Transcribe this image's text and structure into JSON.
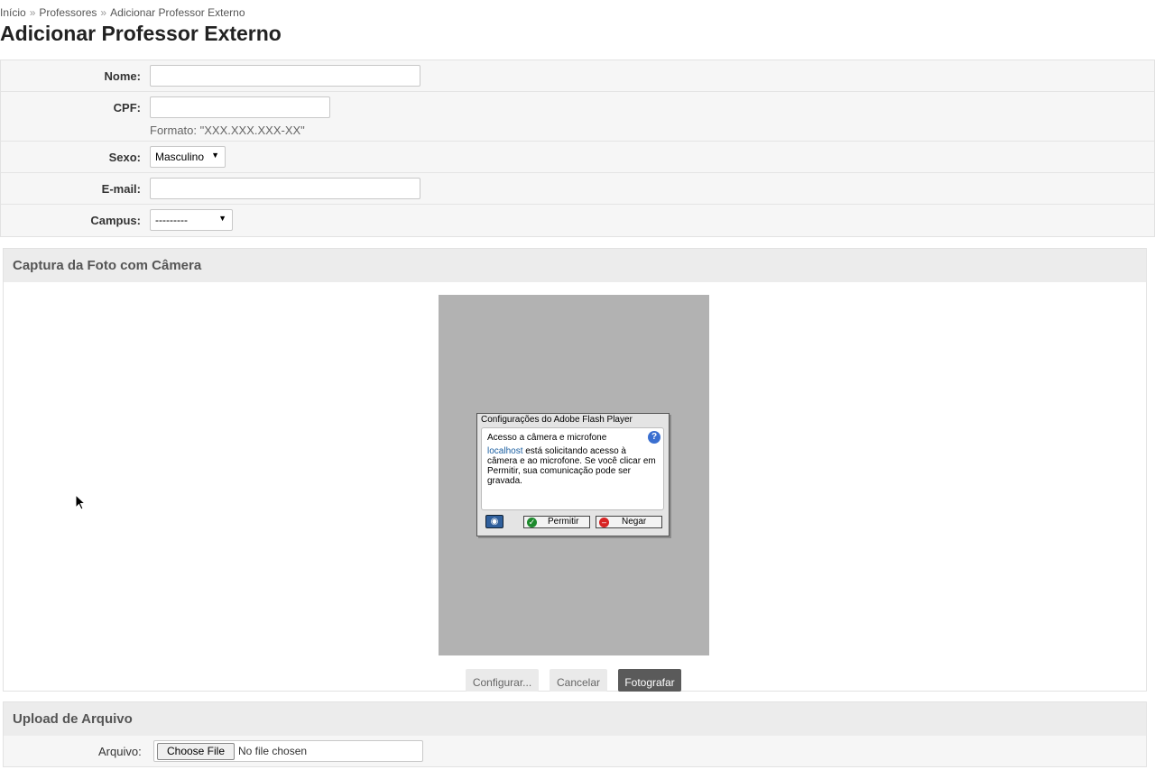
{
  "breadcrumb": {
    "items": [
      "Início",
      "Professores",
      "Adicionar Professor Externo"
    ],
    "separator": "»"
  },
  "page_title": "Adicionar Professor Externo",
  "form": {
    "nome": {
      "label": "Nome:",
      "value": ""
    },
    "cpf": {
      "label": "CPF:",
      "value": "",
      "help": "Formato: \"XXX.XXX.XXX-XX\""
    },
    "sexo": {
      "label": "Sexo:",
      "selected": "Masculino"
    },
    "email": {
      "label": "E-mail:",
      "value": ""
    },
    "campus": {
      "label": "Campus:",
      "selected": "---------"
    }
  },
  "camera_panel": {
    "title": "Captura da Foto com Câmera",
    "flash_dialog": {
      "title": "Configurações do Adobe Flash Player",
      "heading": "Acesso a câmera e microfone",
      "host": "localhost",
      "message": "está solicitando acesso à câmera e ao microfone. Se você clicar em Permitir, sua comunicação pode ser gravada.",
      "allow_label": "Permitir",
      "deny_label": "Negar",
      "help_glyph": "?"
    },
    "buttons": {
      "configure": "Configurar...",
      "cancel": "Cancelar",
      "capture": "Fotografar"
    }
  },
  "upload_panel": {
    "title": "Upload de Arquivo",
    "label": "Arquivo:",
    "choose_label": "Choose File",
    "status": "No file chosen"
  },
  "colors": {
    "capture_button": "#5a5a5a",
    "panel_header": "#ececec",
    "camera_area": "#b2b2b2"
  }
}
